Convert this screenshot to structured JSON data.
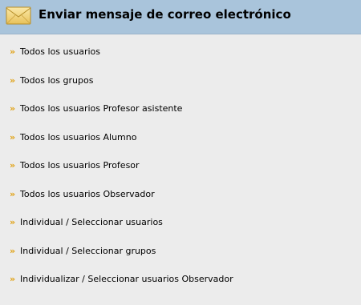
{
  "header": {
    "icon": "envelope-icon",
    "title": "Enviar mensaje de correo electrónico"
  },
  "menu": {
    "bullet": "»",
    "items": [
      {
        "label": "Todos los usuarios"
      },
      {
        "label": "Todos los grupos"
      },
      {
        "label": "Todos los usuarios Profesor asistente"
      },
      {
        "label": "Todos los usuarios Alumno"
      },
      {
        "label": "Todos los usuarios Profesor"
      },
      {
        "label": "Todos los usuarios Observador"
      },
      {
        "label": "Individual / Seleccionar usuarios"
      },
      {
        "label": "Individual / Seleccionar grupos"
      },
      {
        "label": "Individualizar / Seleccionar usuarios Observador"
      }
    ]
  },
  "colors": {
    "header_bg": "#a9c4db",
    "page_bg": "#ececec",
    "bullet": "#e0a010"
  }
}
